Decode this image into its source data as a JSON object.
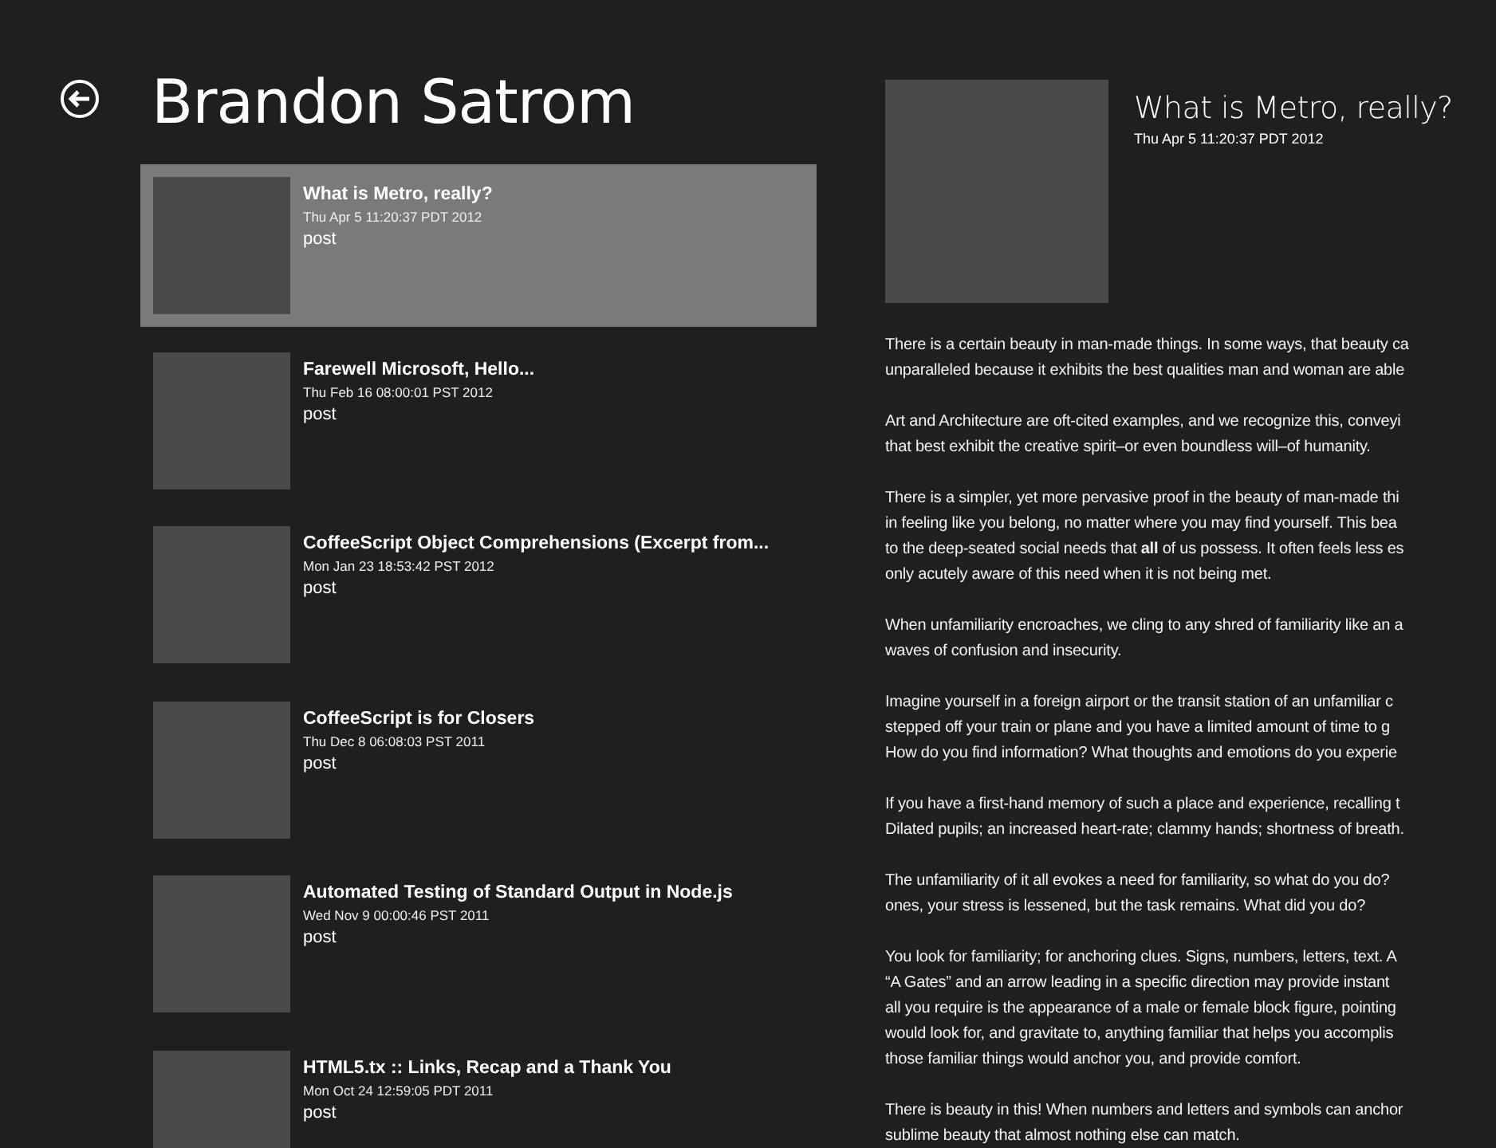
{
  "header": {
    "title": "Brandon Satrom"
  },
  "posts": [
    {
      "title": "What is Metro, really?",
      "date": "Thu Apr 5 11:20:37 PDT 2012",
      "type": "post",
      "selected": true
    },
    {
      "title": "Farewell Microsoft, Hello...",
      "date": "Thu Feb 16 08:00:01 PST 2012",
      "type": "post",
      "selected": false
    },
    {
      "title": "CoffeeScript Object Comprehensions (Excerpt from...",
      "date": "Mon Jan 23 18:53:42 PST 2012",
      "type": "post",
      "selected": false
    },
    {
      "title": "CoffeeScript is for Closers",
      "date": "Thu Dec 8 06:08:03 PST 2011",
      "type": "post",
      "selected": false
    },
    {
      "title": "Automated Testing of Standard Output in Node.js",
      "date": "Wed Nov 9 00:00:46 PST 2011",
      "type": "post",
      "selected": false
    },
    {
      "title": "HTML5.tx :: Links, Recap and a Thank You",
      "date": "Mon Oct 24 12:59:05 PDT 2011",
      "type": "post",
      "selected": false
    }
  ],
  "detail": {
    "title": "What is Metro, really?",
    "date": "Thu Apr 5 11:20:37 PDT 2012",
    "paragraphs": [
      [
        "There is a certain beauty in man-made things. In some ways, that beauty ca",
        "unparalleled because it exhibits the best qualities man and woman are able"
      ],
      [
        "Art and Architecture are oft-cited examples, and we recognize this, conveyi",
        "that best exhibit the creative spirit–or even boundless will–of humanity."
      ],
      [
        "There is a simpler, yet more pervasive proof in the beauty of man-made thi",
        "in feeling like you belong, no matter where you may find yourself. This bea",
        "to the deep-seated social needs that **all** of us possess. It often feels less es",
        "only acutely aware of this need when it is not being met."
      ],
      [
        "When unfamiliarity encroaches, we cling to any shred of familiarity like an a",
        "waves of confusion and insecurity."
      ],
      [
        "Imagine yourself in a foreign airport or the transit station of an unfamiliar c",
        "stepped off your train or plane and you have a limited amount of time to g",
        "How do you find information? What thoughts and emotions do you experie"
      ],
      [
        "If you have a first-hand memory of such a place and experience, recalling t",
        "Dilated pupils; an increased heart-rate; clammy hands; shortness of breath."
      ],
      [
        "The unfamiliarity of it all evokes a need for familiarity, so what do you do?",
        "ones, your stress is lessened, but the task remains. What did you do?"
      ],
      [
        "You look for familiarity; for anchoring clues. Signs, numbers, letters, text. A",
        "“A Gates” and an arrow leading in a specific direction may provide instant",
        "all you require is the appearance of a male or female block figure, pointing",
        "would look for, and gravitate to, anything familiar that helps you accomplis",
        "those familiar things would anchor you, and provide comfort."
      ],
      [
        "There is beauty in this! When numbers and letters and symbols can anchor",
        "sublime beauty that almost nothing else can match."
      ]
    ]
  }
}
